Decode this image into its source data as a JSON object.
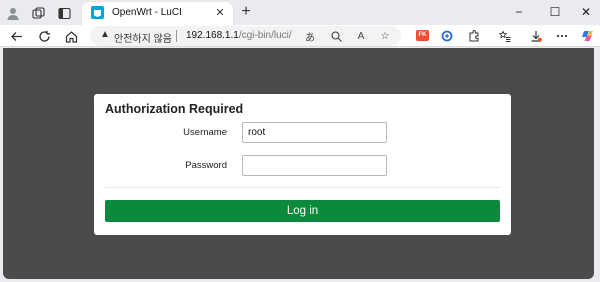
{
  "browser": {
    "tab": {
      "title": "OpenWrt - LuCI"
    },
    "new_tab_label": "+",
    "window_controls": {
      "minimize": "−",
      "maximize": "☐",
      "close": "✕"
    },
    "address": {
      "security_label": "안전하지 않음",
      "host": "192.168.1.1",
      "path": "/cgi-bin/luci/"
    },
    "extension_badge": "FK"
  },
  "login": {
    "title": "Authorization Required",
    "username_label": "Username",
    "username_value": "root",
    "password_label": "Password",
    "password_value": "",
    "submit_label": "Log in"
  },
  "colors": {
    "page_background": "#4b4b4b",
    "login_button": "#0b8a3b"
  }
}
